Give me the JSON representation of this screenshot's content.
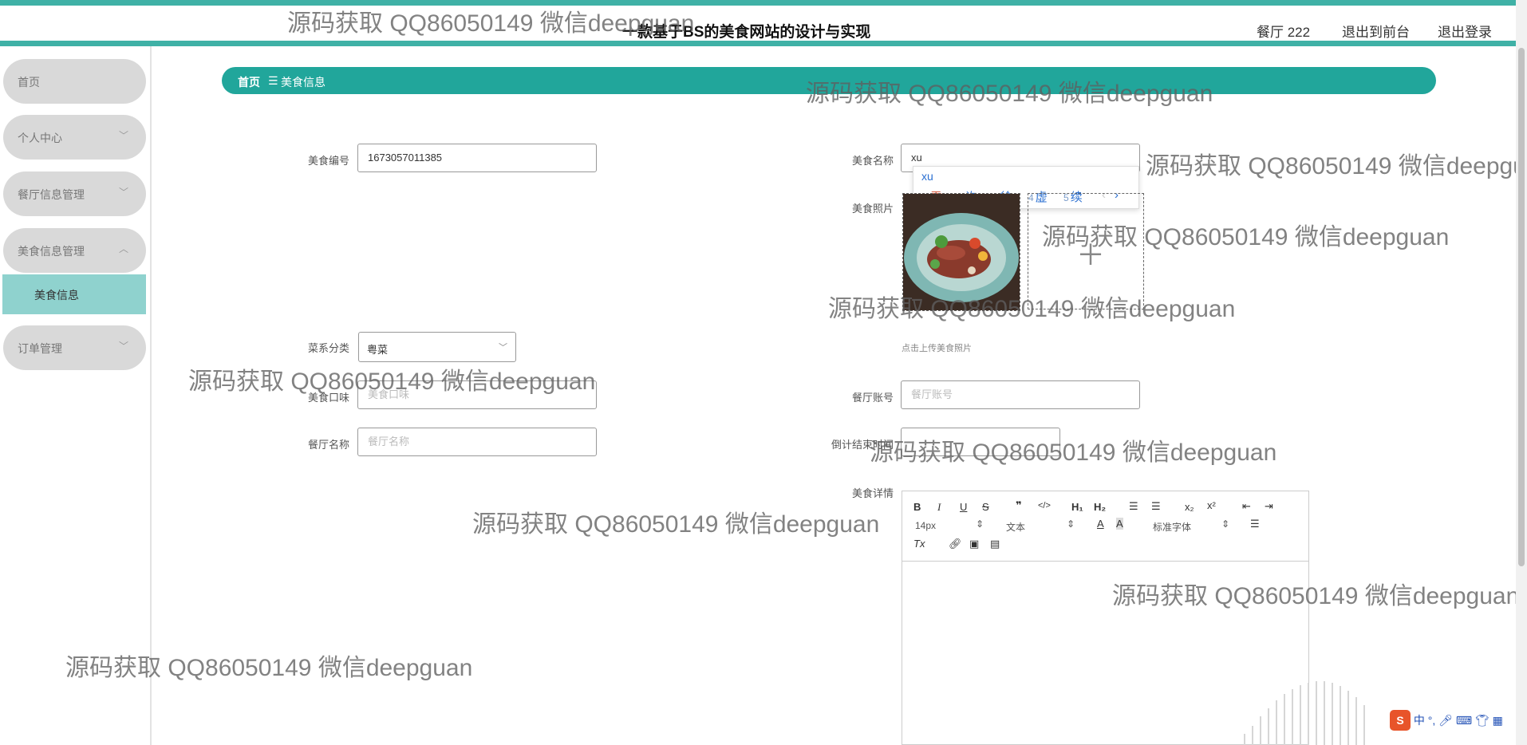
{
  "header": {
    "title": "一款基于BS的美食网站的设计与实现",
    "user": "餐厅 222",
    "back_front": "退出到前台",
    "logout": "退出登录"
  },
  "sidebar": {
    "items": [
      {
        "label": "首页"
      },
      {
        "label": "个人中心"
      },
      {
        "label": "餐厅信息管理"
      },
      {
        "label": "美食信息管理"
      },
      {
        "label": "订单管理"
      }
    ],
    "sub_item": "美食信息"
  },
  "breadcrumb": {
    "home": "首页",
    "sep": "☰",
    "current": "美食信息"
  },
  "form": {
    "code": {
      "label": "美食编号",
      "value": "1673057011385"
    },
    "name": {
      "label": "美食名称",
      "value": "xu"
    },
    "photo": {
      "label": "美食照片",
      "hint": "点击上传美食照片"
    },
    "category": {
      "label": "菜系分类",
      "value": "粤菜"
    },
    "taste": {
      "label": "美食口味",
      "placeholder": "美食口味"
    },
    "account": {
      "label": "餐厅账号",
      "placeholder": "餐厅账号"
    },
    "restaurant": {
      "label": "餐厅名称",
      "placeholder": "餐厅名称"
    },
    "deadline": {
      "label": "倒计结束时间"
    },
    "detail": {
      "label": "美食详情"
    }
  },
  "ime": {
    "composition": "xu",
    "candidates": [
      {
        "n": "1",
        "t": "需"
      },
      {
        "n": "2",
        "t": "许"
      },
      {
        "n": "3",
        "t": "徐"
      },
      {
        "n": "4",
        "t": "虚"
      },
      {
        "n": "5",
        "t": "续"
      }
    ]
  },
  "editor": {
    "size": "14px",
    "format": "文本",
    "font": "标准字体"
  },
  "watermark": "源码获取 QQ86050149 微信deepguan",
  "ime_bar": {
    "lang": "中"
  },
  "colors": {
    "accent": "#21a69b",
    "sidebar_active": "#8fd2ce",
    "sidebar_item": "#d9d9d9"
  }
}
